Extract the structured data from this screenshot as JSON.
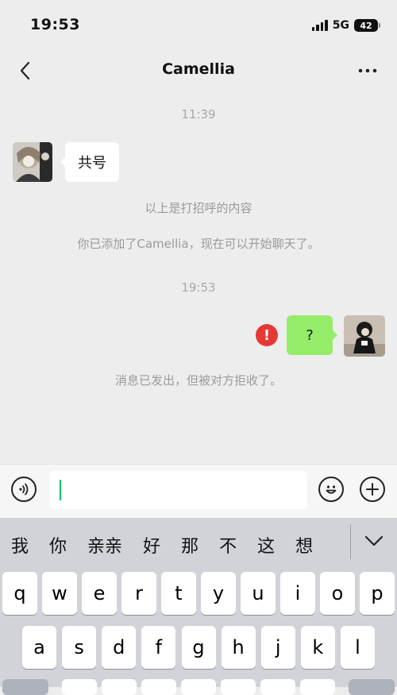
{
  "status_bar": {
    "time": "19:53",
    "network": "5G",
    "battery": "42"
  },
  "nav": {
    "title": "Camellia"
  },
  "chat": {
    "timestamp_1": "11:39",
    "incoming_message": "共号",
    "system_greeting_note": "以上是打招呼的内容",
    "system_added_note": "你已添加了Camellia，现在可以开始聊天了。",
    "timestamp_2": "19:53",
    "outgoing_message": "?",
    "rejected_note": "消息已发出，但被对方拒收了。"
  },
  "input": {
    "value": ""
  },
  "keyboard": {
    "candidates": [
      "我",
      "你",
      "亲亲",
      "好",
      "那",
      "不",
      "这",
      "想"
    ],
    "row1": [
      "q",
      "w",
      "e",
      "r",
      "t",
      "y",
      "u",
      "i",
      "o",
      "p"
    ],
    "row2": [
      "a",
      "s",
      "d",
      "f",
      "g",
      "h",
      "j",
      "k",
      "l"
    ]
  },
  "colors": {
    "sent_bubble": "#95ec69",
    "error": "#e53935",
    "caret": "#16c060"
  },
  "icons": {
    "back": "chevron-left-icon",
    "more": "more-horizontal-icon",
    "error": "exclamation-circle-icon",
    "voice": "voice-wave-icon",
    "emoji": "smiley-icon",
    "plus": "plus-circle-icon",
    "collapse": "chevron-down-icon"
  }
}
